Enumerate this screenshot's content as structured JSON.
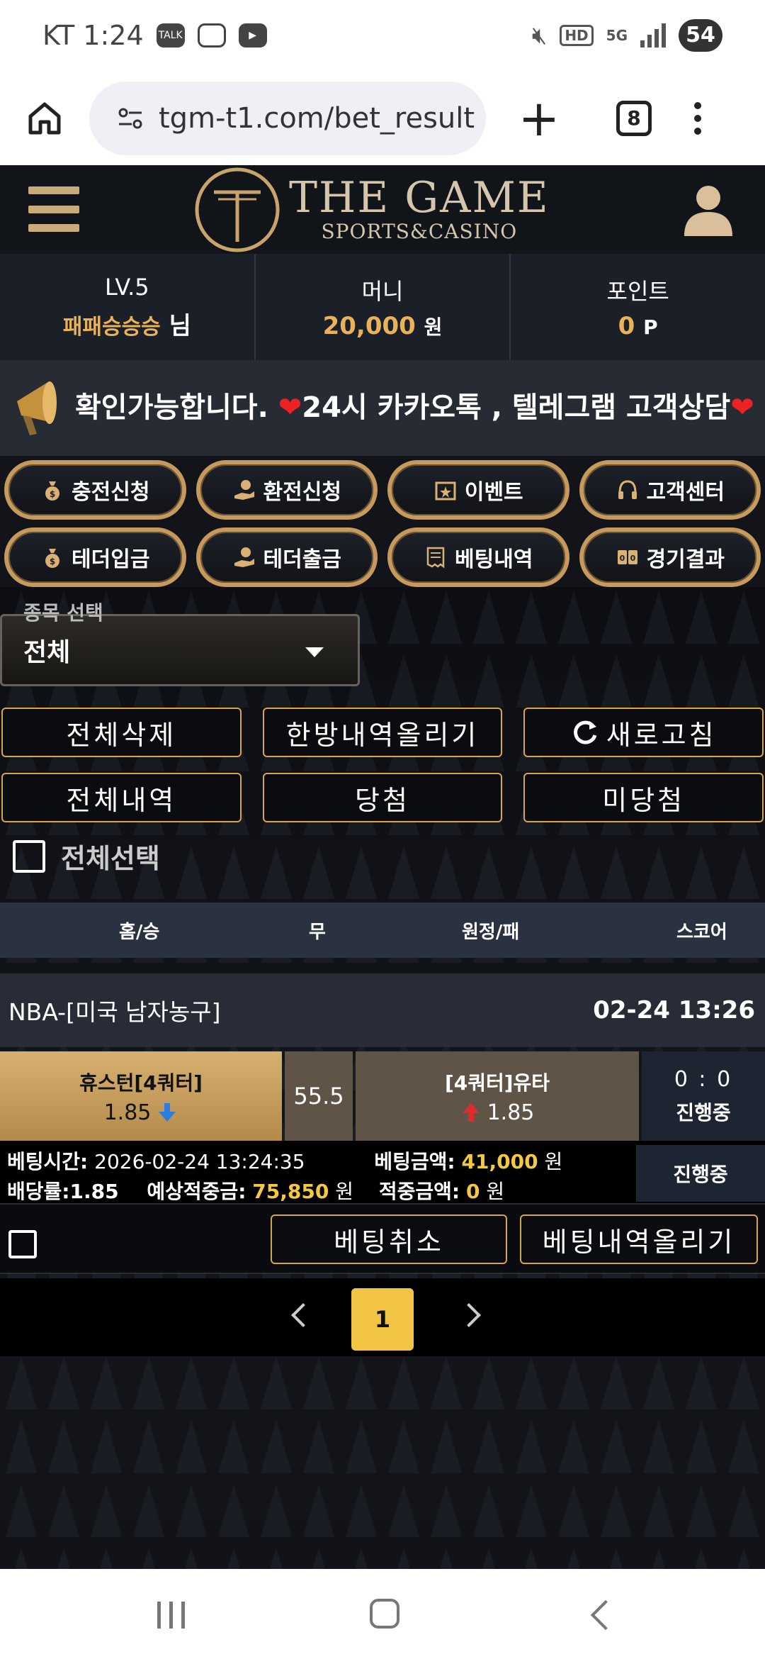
{
  "status_bar": {
    "carrier": "KT",
    "time": "1:24",
    "notif_icons": [
      "talk-icon",
      "screenshot-icon",
      "youtube-icon"
    ],
    "sys_icons": [
      "mute-icon",
      "hd-icon",
      "5g-icon",
      "signal-icon"
    ],
    "battery": "54"
  },
  "browser": {
    "url": "tgm-t1.com/bet_result",
    "tab_count": "8"
  },
  "site": {
    "logo_title": "THE GAME",
    "logo_sub": "SPORTS&CASINO"
  },
  "user_info": {
    "level": "LV.5",
    "nickname": "패패승승승",
    "honorific": "님",
    "money_label": "머니",
    "money_value": "20,000",
    "money_unit": "원",
    "points_label": "포인트",
    "points_value": "0",
    "points_unit": "P"
  },
  "notice": {
    "text_before": "확인가능합니다. ",
    "text_middle": "24시 카카오톡 , 텔레그램 고객상담"
  },
  "quick_menu": [
    {
      "label": "충전신청",
      "icon": "money-bag-icon"
    },
    {
      "label": "환전신청",
      "icon": "hand-coin-icon"
    },
    {
      "label": "이벤트",
      "icon": "calendar-star-icon"
    },
    {
      "label": "고객센터",
      "icon": "headset-icon"
    },
    {
      "label": "테더입금",
      "icon": "money-bag-icon"
    },
    {
      "label": "테더출금",
      "icon": "hand-coin-icon"
    },
    {
      "label": "베팅내역",
      "icon": "receipt-icon"
    },
    {
      "label": "경기결과",
      "icon": "scoreboard-icon"
    }
  ],
  "filter": {
    "label": "종목 선택",
    "value": "전체"
  },
  "actions": {
    "delete_all": "전체삭제",
    "upload_all": "한방내역올리기",
    "refresh": "새로고침",
    "all_history": "전체내역",
    "won": "당첨",
    "not_won": "미당첨",
    "select_all": "전체선택"
  },
  "table_header": {
    "home": "홈/승",
    "draw": "무",
    "away": "원정/패",
    "score": "스코어"
  },
  "bet": {
    "league": "NBA-[미국 남자농구]",
    "game_time": "02-24 13:26",
    "home_team": "휴스턴[4쿼터]",
    "home_odds": "1.85",
    "handicap": "55.5",
    "away_team": "[4쿼터]유타",
    "away_odds": "1.85",
    "score": "0 : 0",
    "status": "진행중",
    "bet_time_label": "베팅시간:",
    "bet_time": "2026-02-24 13:24:35",
    "bet_amount_label": "베팅금액:",
    "bet_amount": "41,000",
    "odds_label": "배당률:",
    "odds": "1.85",
    "expected_label": "예상적중금:",
    "expected": "75,850",
    "win_label": "적중금액:",
    "win_amount": "0",
    "currency": "원",
    "result_status": "진행중",
    "cancel_label": "베팅취소",
    "upload_label": "베팅내역올리기"
  },
  "pagination": {
    "current": "1"
  },
  "colors": {
    "gold": "#d8a548",
    "accent_yellow": "#f2c443",
    "header_bg": "#111419"
  }
}
